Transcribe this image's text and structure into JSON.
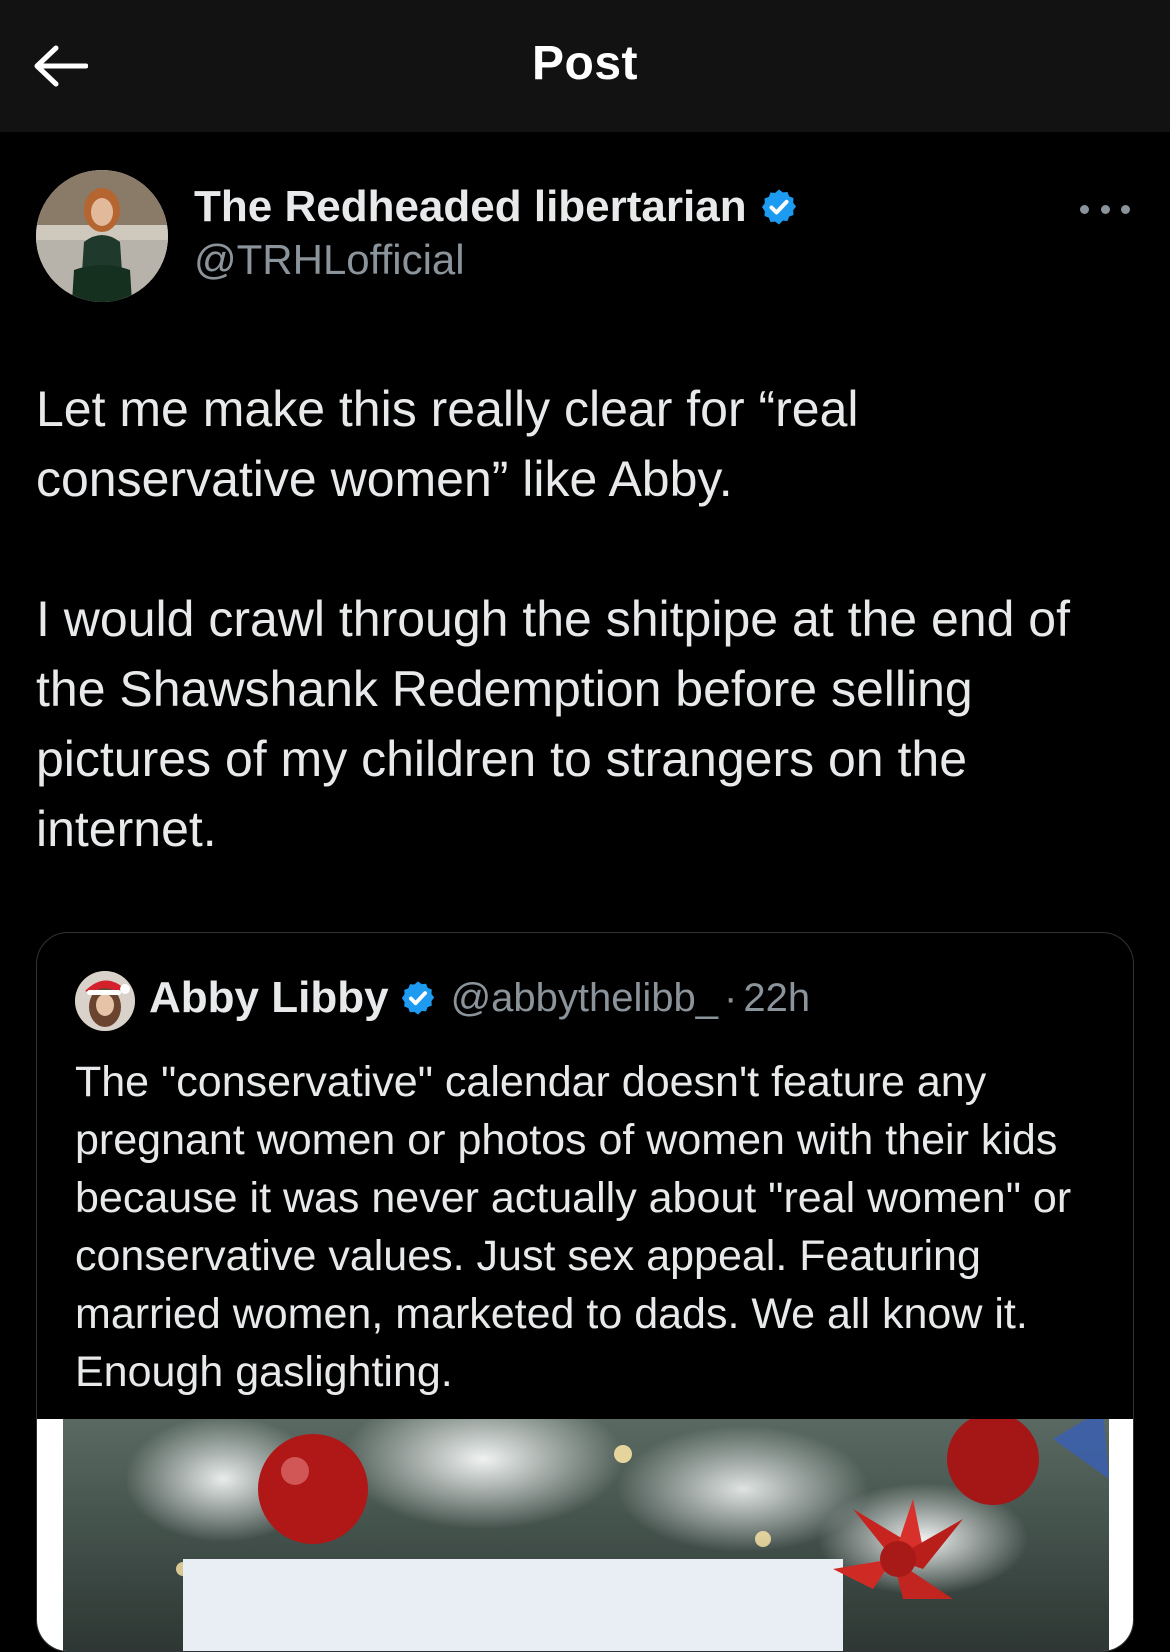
{
  "header": {
    "title": "Post",
    "back_icon": "arrow-left-icon"
  },
  "post": {
    "author_name": "The Redheaded libertarian",
    "author_handle": "@TRHLofficial",
    "verified": true,
    "text": "Let me make this really clear for “real conservative women” like Abby.\n\nI would crawl through the shitpipe at the end of the Shawshank Redemption before selling pictures of my children to strangers on the internet."
  },
  "quoted_post": {
    "author_name": "Abby Libby",
    "author_handle": "@abbythelibb_",
    "separator": "·",
    "time": "22h",
    "verified": true,
    "text": "The \"conservative\" calendar doesn't feature any pregnant women or photos of women with their kids because it was never actually about \"real women\" or conservative values.  Just sex appeal. Featuring married women, marketed to dads. We all know it. Enough gaslighting."
  },
  "colors": {
    "background": "#000000",
    "topbar": "#121212",
    "text": "#e7e9ea",
    "muted": "#8b949b",
    "verified": "#1d9bf0",
    "border": "#2f3336"
  }
}
